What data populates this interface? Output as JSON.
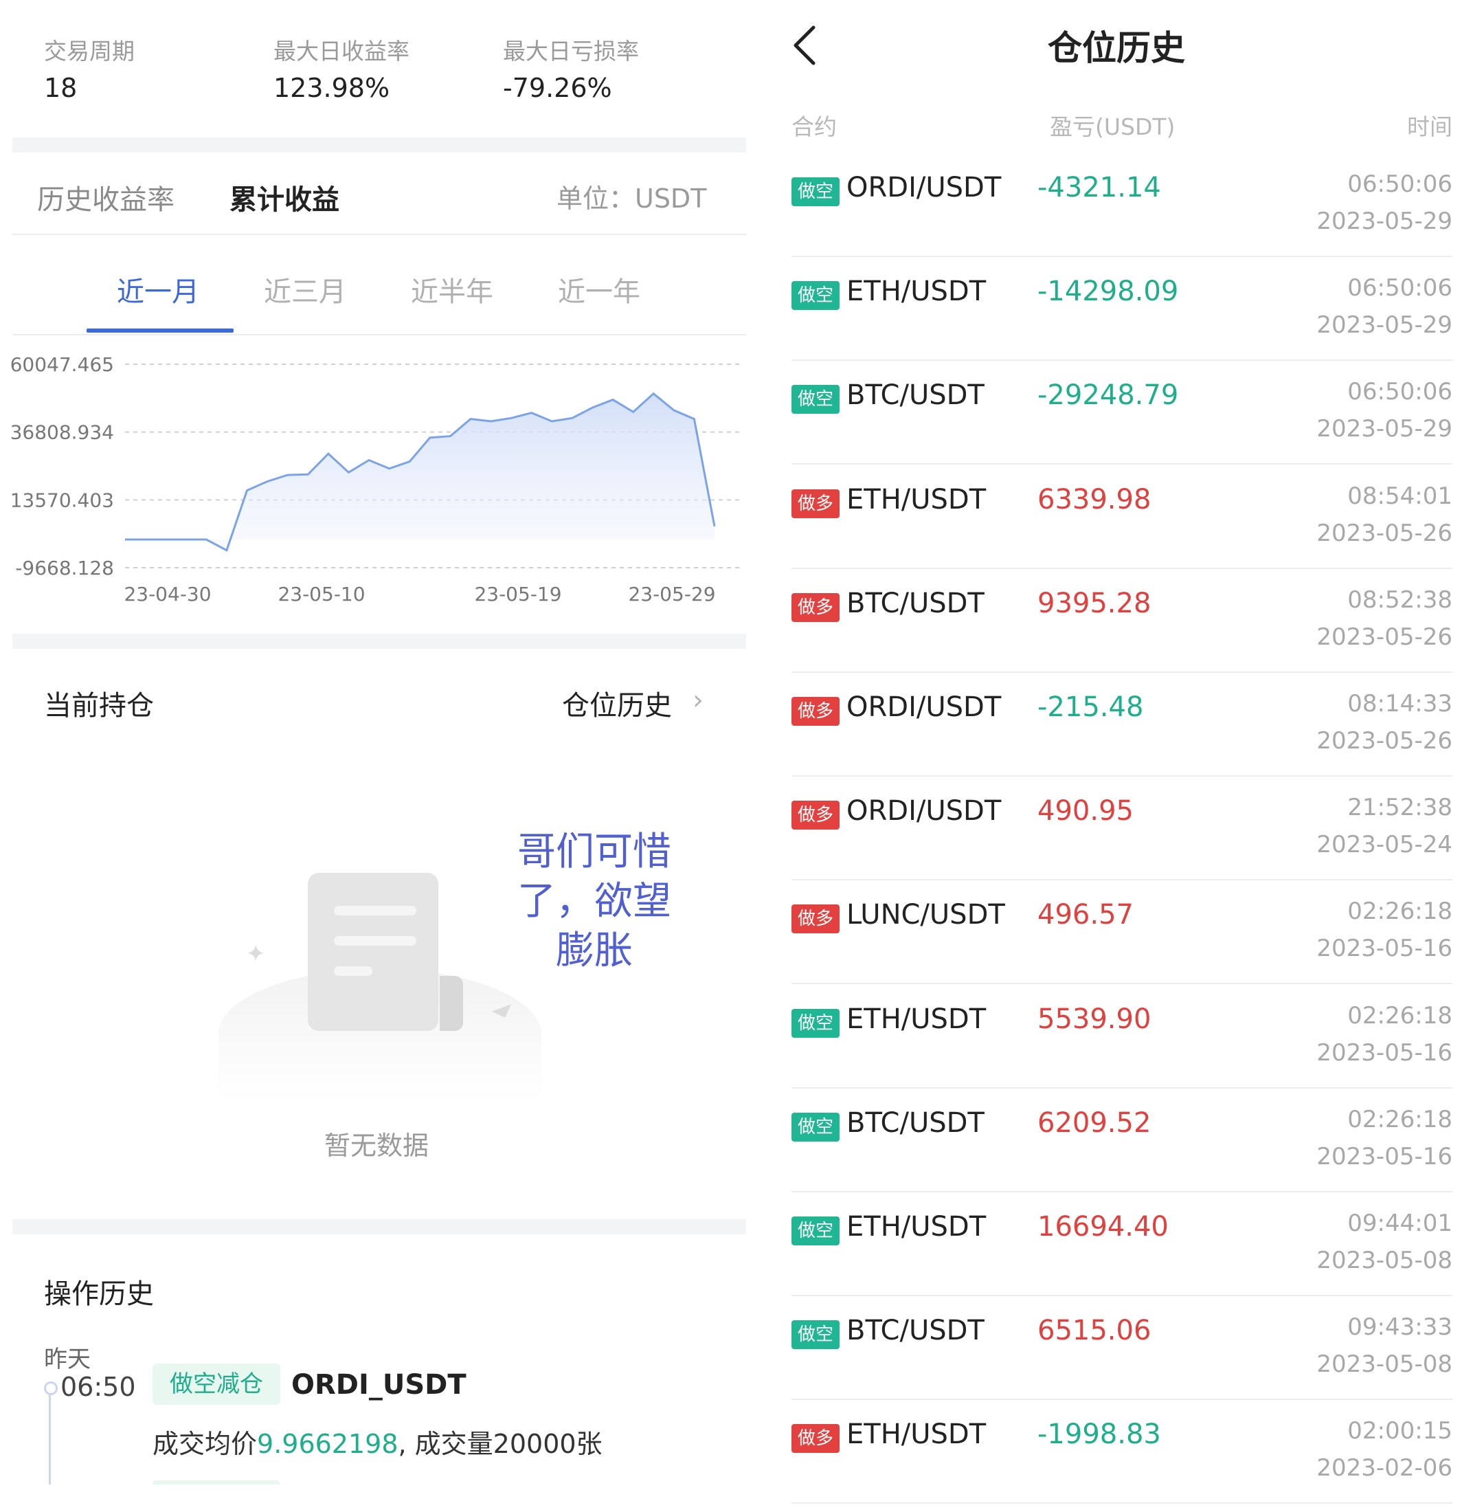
{
  "stats": [
    {
      "label": "交易周期",
      "value": "18"
    },
    {
      "label": "最大日收益率",
      "value": "123.98%"
    },
    {
      "label": "最大日亏损率",
      "value": "-79.26%"
    }
  ],
  "tabs": {
    "history_rate": "历史收益率",
    "cumulative": "累计收益",
    "unit": "单位：USDT"
  },
  "periods": [
    "近一月",
    "近三月",
    "近半年",
    "近一年"
  ],
  "chart_data": {
    "type": "area",
    "y_ticks": [
      "60047.465",
      "36808.934",
      "13570.403",
      "-9668.128"
    ],
    "x_ticks": [
      "23-04-30",
      "23-05-10",
      "23-05-19",
      "23-05-29"
    ],
    "ylim": [
      -9668.128,
      60047.465
    ],
    "x": [
      "04-30",
      "05-01",
      "05-02",
      "05-03",
      "05-04",
      "05-05",
      "05-06",
      "05-07",
      "05-08",
      "05-09",
      "05-10",
      "05-11",
      "05-12",
      "05-13",
      "05-14",
      "05-15",
      "05-16",
      "05-17",
      "05-18",
      "05-19",
      "05-20",
      "05-21",
      "05-22",
      "05-23",
      "05-24",
      "05-25",
      "05-26",
      "05-27",
      "05-28",
      "05-29",
      "05-30"
    ],
    "values": [
      0,
      0,
      0,
      0,
      0,
      -3700,
      16800,
      19900,
      22100,
      22300,
      29400,
      23000,
      27200,
      24300,
      26700,
      34900,
      35400,
      41300,
      40500,
      41600,
      43400,
      40500,
      41600,
      45200,
      47900,
      43700,
      50000,
      44300,
      41300,
      4500
    ],
    "grid": true,
    "color": "#7ba3e8"
  },
  "holdings": {
    "title": "当前持仓",
    "history_link": "仓位历史",
    "empty": "暂无数据"
  },
  "overlay_text": [
    "哥们可惜",
    "了，欲望",
    "膨胀"
  ],
  "ops": {
    "title": "操作历史",
    "day": "昨天",
    "time": "06:50",
    "tag": "做空减仓",
    "symbol": "ORDI_USDT",
    "detail_prefix": "成交均价",
    "price": "9.9662198",
    "detail_suffix": ", 成交量20000张"
  },
  "right": {
    "back_icon": "chevron-left-icon",
    "title": "仓位历史",
    "headers": {
      "contract": "合约",
      "pnl": "盈亏(USDT)",
      "time": "时间"
    },
    "rows": [
      {
        "side": "做空",
        "pair": "ORDI/USDT",
        "pnl": "-4321.14",
        "time": "06:50:06",
        "date": "2023-05-29"
      },
      {
        "side": "做空",
        "pair": "ETH/USDT",
        "pnl": "-14298.09",
        "time": "06:50:06",
        "date": "2023-05-29"
      },
      {
        "side": "做空",
        "pair": "BTC/USDT",
        "pnl": "-29248.79",
        "time": "06:50:06",
        "date": "2023-05-29"
      },
      {
        "side": "做多",
        "pair": "ETH/USDT",
        "pnl": "6339.98",
        "time": "08:54:01",
        "date": "2023-05-26"
      },
      {
        "side": "做多",
        "pair": "BTC/USDT",
        "pnl": "9395.28",
        "time": "08:52:38",
        "date": "2023-05-26"
      },
      {
        "side": "做多",
        "pair": "ORDI/USDT",
        "pnl": "-215.48",
        "time": "08:14:33",
        "date": "2023-05-26"
      },
      {
        "side": "做多",
        "pair": "ORDI/USDT",
        "pnl": "490.95",
        "time": "21:52:38",
        "date": "2023-05-24"
      },
      {
        "side": "做多",
        "pair": "LUNC/USDT",
        "pnl": "496.57",
        "time": "02:26:18",
        "date": "2023-05-16"
      },
      {
        "side": "做空",
        "pair": "ETH/USDT",
        "pnl": "5539.90",
        "time": "02:26:18",
        "date": "2023-05-16"
      },
      {
        "side": "做空",
        "pair": "BTC/USDT",
        "pnl": "6209.52",
        "time": "02:26:18",
        "date": "2023-05-16"
      },
      {
        "side": "做空",
        "pair": "ETH/USDT",
        "pnl": "16694.40",
        "time": "09:44:01",
        "date": "2023-05-08"
      },
      {
        "side": "做空",
        "pair": "BTC/USDT",
        "pnl": "6515.06",
        "time": "09:43:33",
        "date": "2023-05-08"
      },
      {
        "side": "做多",
        "pair": "ETH/USDT",
        "pnl": "-1998.83",
        "time": "02:00:15",
        "date": "2023-02-06"
      }
    ]
  }
}
